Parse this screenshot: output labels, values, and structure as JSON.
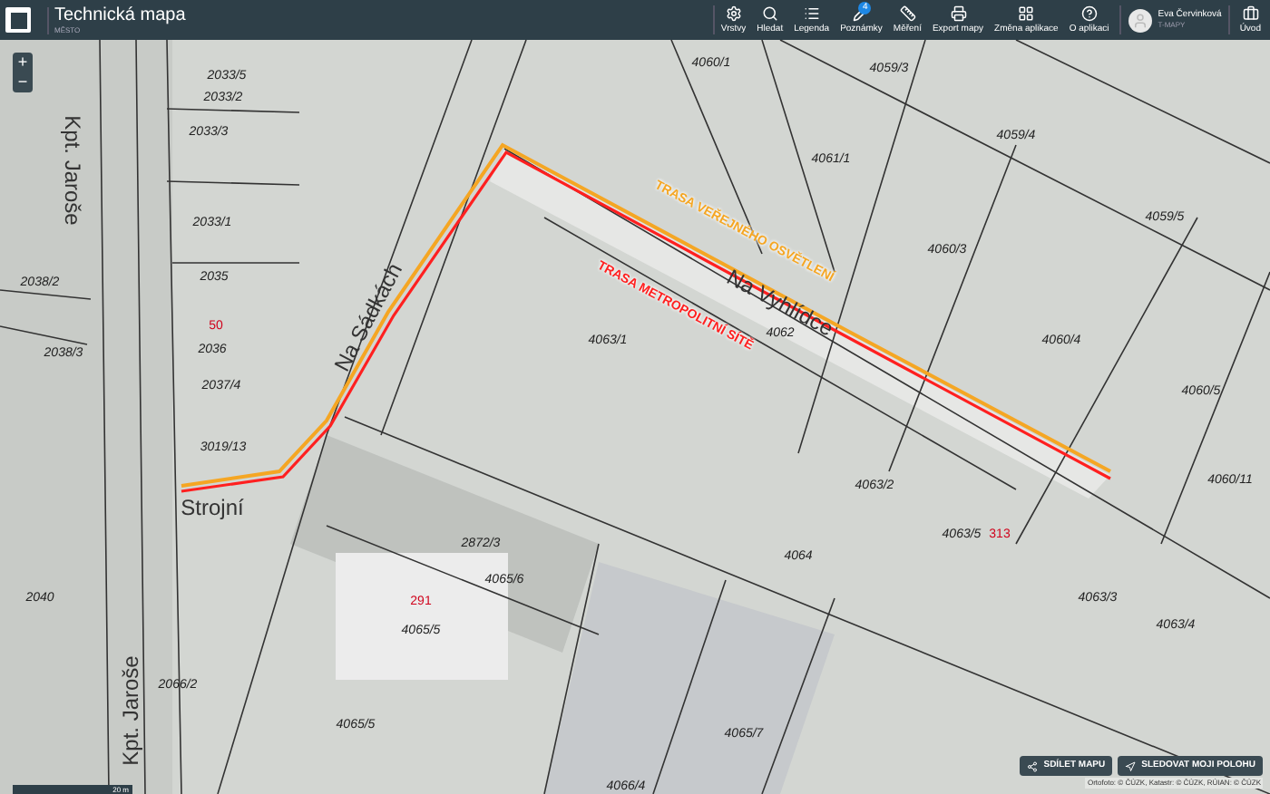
{
  "app": {
    "title": "Technická mapa",
    "subtitle": "MĚSTO"
  },
  "toolbar": [
    {
      "label": "Vrstvy",
      "kind": "layers"
    },
    {
      "label": "Hledat",
      "kind": "search"
    },
    {
      "label": "Legenda",
      "kind": "legend"
    },
    {
      "label": "Poznámky",
      "kind": "notes",
      "badge": "4"
    },
    {
      "label": "Měření",
      "kind": "measure"
    },
    {
      "label": "Export mapy",
      "kind": "export"
    },
    {
      "label": "Změna aplikace",
      "kind": "apps"
    },
    {
      "label": "O aplikaci",
      "kind": "help"
    }
  ],
  "user": {
    "name": "Eva Červinková",
    "role": "T-MAPY"
  },
  "home": {
    "label": "Úvod"
  },
  "zoom": [
    "+",
    "−"
  ],
  "map_labels": [
    {
      "text": "2033/5",
      "kind": "parcel"
    },
    {
      "text": "2033/2",
      "kind": "parcel"
    },
    {
      "text": "2033/3",
      "kind": "parcel"
    },
    {
      "text": "2033/1",
      "kind": "parcel"
    },
    {
      "text": "2035",
      "kind": "parcel"
    },
    {
      "text": "2038/2",
      "kind": "parcel"
    },
    {
      "text": "2038/3",
      "kind": "parcel"
    },
    {
      "text": "50",
      "kind": "address"
    },
    {
      "text": "2036",
      "kind": "parcel"
    },
    {
      "text": "2037/4",
      "kind": "parcel"
    },
    {
      "text": "3019/13",
      "kind": "parcel"
    },
    {
      "text": "2040",
      "kind": "parcel"
    },
    {
      "text": "2066/2",
      "kind": "parcel"
    },
    {
      "text": "4060/1",
      "kind": "parcel"
    },
    {
      "text": "4059/3",
      "kind": "parcel"
    },
    {
      "text": "4061/1",
      "kind": "parcel"
    },
    {
      "text": "4059/4",
      "kind": "parcel"
    },
    {
      "text": "4059/5",
      "kind": "parcel"
    },
    {
      "text": "4060/3",
      "kind": "parcel"
    },
    {
      "text": "4063/1",
      "kind": "parcel"
    },
    {
      "text": "4062",
      "kind": "parcel"
    },
    {
      "text": "4060/4",
      "kind": "parcel"
    },
    {
      "text": "4060/5",
      "kind": "parcel"
    },
    {
      "text": "4060/11",
      "kind": "parcel"
    },
    {
      "text": "4063/2",
      "kind": "parcel"
    },
    {
      "text": "4063/5",
      "kind": "parcel"
    },
    {
      "text": "313",
      "kind": "address"
    },
    {
      "text": "4064",
      "kind": "parcel"
    },
    {
      "text": "2872/3",
      "kind": "parcel"
    },
    {
      "text": "4065/6",
      "kind": "parcel"
    },
    {
      "text": "291",
      "kind": "address"
    },
    {
      "text": "4065/5",
      "kind": "parcel"
    },
    {
      "text": "4065/7",
      "kind": "parcel"
    },
    {
      "text": "4066/4",
      "kind": "parcel"
    },
    {
      "text": "4063/3",
      "kind": "parcel"
    },
    {
      "text": "4063/4",
      "kind": "parcel"
    },
    {
      "text": "4065/5",
      "kind": "parcel"
    },
    {
      "text": "Kpt. Jaroše",
      "kind": "street"
    },
    {
      "text": "Kpt. Jaroše",
      "kind": "street"
    },
    {
      "text": "Na Sádkách",
      "kind": "street"
    },
    {
      "text": "Strojní",
      "kind": "street"
    },
    {
      "text": "Na Vyhlídce",
      "kind": "street"
    }
  ],
  "routes": [
    {
      "label": "TRASA VEŘEJNÉHO OSVĚTLENÍ",
      "color": "#f5a623"
    },
    {
      "label": "TRASA METROPOLITNÍ SÍTĚ",
      "color": "#ff2020"
    }
  ],
  "scale": "20 m",
  "actions": [
    {
      "label": "SDÍLET MAPU",
      "kind": "share"
    },
    {
      "label": "SLEDOVAT MOJI POLOHU",
      "kind": "locate"
    }
  ],
  "attribution": "Ortofoto: © ČÚZK, Katastr: © ČÚZK, RÚIAN: © ČÚZK"
}
